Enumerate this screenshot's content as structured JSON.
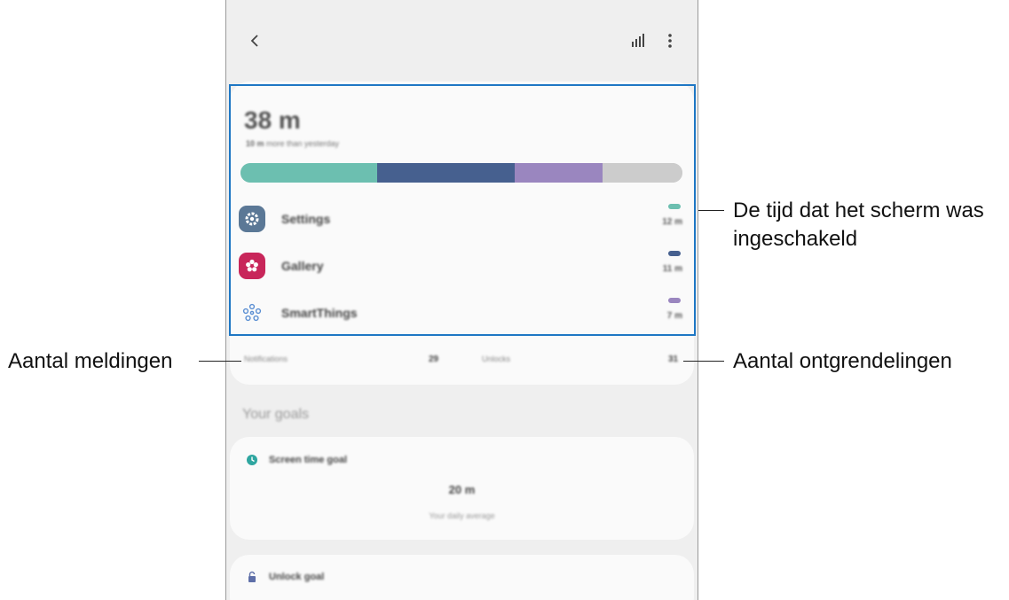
{
  "screen": {
    "usage": {
      "total_time": "38 m",
      "compare_amount": "10 m",
      "compare_text": " more than yesterday",
      "bar_fractions": [
        0.31,
        0.31,
        0.2,
        0.18
      ],
      "bar_colors": [
        "#6cbfb0",
        "#46608f",
        "#9a86bf",
        "#cccccc"
      ],
      "apps": [
        {
          "name": "Settings",
          "time": "12 m",
          "color": "#6cbfb0",
          "icon": "gear-icon"
        },
        {
          "name": "Gallery",
          "time": "11 m",
          "color": "#46608f",
          "icon": "flower-icon"
        },
        {
          "name": "SmartThings",
          "time": "7 m",
          "color": "#9a86bf",
          "icon": "smartthings-icon"
        }
      ],
      "notifications_label": "Notifications",
      "notifications_count": "29",
      "unlocks_label": "Unlocks",
      "unlocks_count": "31"
    },
    "goals": {
      "section_title": "Your goals",
      "screen_time_goal_label": "Screen time goal",
      "screen_time_goal_value": "20 m",
      "screen_time_goal_sub": "Your daily average",
      "unlock_goal_label": "Unlock goal"
    },
    "icons": {
      "back": "back-arrow-icon",
      "chart": "bar-chart-icon",
      "more": "more-vertical-icon"
    }
  },
  "callouts": {
    "screen_on_time_line1": "De tijd dat het scherm was",
    "screen_on_time_line2": "ingeschakeld",
    "notifications": "Aantal meldingen",
    "unlocks": "Aantal ontgrendelingen"
  },
  "colors": {
    "highlight": "#1e77c4",
    "settings_icon_bg": "#5b7896",
    "gallery_icon_bg": "#c8265a",
    "smartthings_icon": "#5b8fd3",
    "goal_clock": "#2fa6a0",
    "unlock_lock": "#5e6fa8"
  }
}
